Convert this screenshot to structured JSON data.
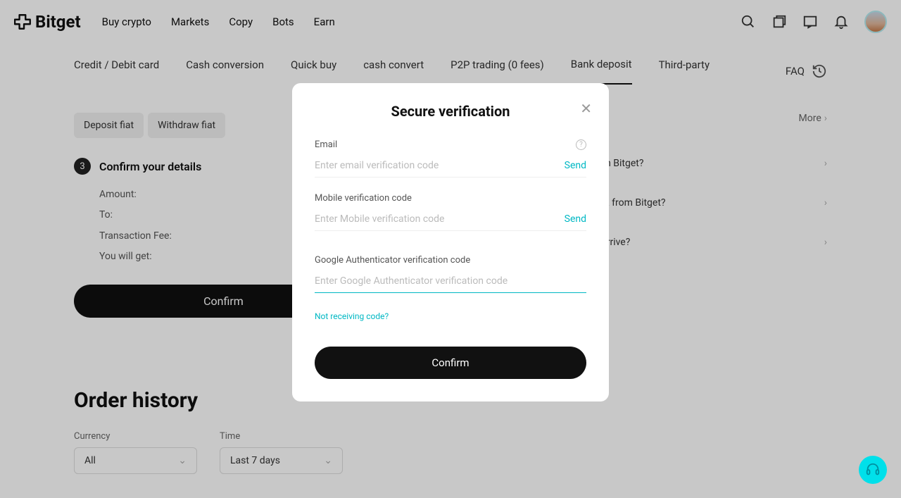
{
  "header": {
    "logo": "Bitget",
    "nav": {
      "buy": "Buy crypto",
      "markets": "Markets",
      "copy": "Copy",
      "bots": "Bots",
      "earn": "Earn"
    }
  },
  "subtabs": {
    "credit": "Credit / Debit card",
    "cash_conv": "Cash conversion",
    "quick_buy": "Quick buy",
    "cash_convert": "cash convert",
    "p2p": "P2P trading (0 fees)",
    "bank": "Bank deposit",
    "third": "Third-party",
    "faq": "FAQ"
  },
  "chips": {
    "deposit": "Deposit fiat",
    "withdraw": "Withdraw fiat"
  },
  "step": {
    "num": "3",
    "title": "Confirm your details"
  },
  "details": {
    "amount": "Amount:",
    "to": "To:",
    "fee": "Transaction Fee:",
    "get": "You will get:"
  },
  "confirm_label": "Confirm",
  "right": {
    "more": "More",
    "faq1_suffix": "R on Bitget?",
    "faq2_suffix": "EUR from Bitget?",
    "faq3_suffix": "ls arrive?"
  },
  "order_history": {
    "title": "Order history",
    "currency_label": "Currency",
    "currency_value": "All",
    "time_label": "Time",
    "time_value": "Last 7 days"
  },
  "modal": {
    "title": "Secure verification",
    "email_label": "Email",
    "email_placeholder": "Enter email verification code",
    "email_send": "Send",
    "mobile_label": "Mobile verification code",
    "mobile_placeholder": "Enter Mobile verification code",
    "mobile_send": "Send",
    "ga_label": "Google Authenticator verification code",
    "ga_placeholder": "Enter Google Authenticator verification code",
    "not_receiving": "Not receiving code?",
    "confirm": "Confirm"
  },
  "colors": {
    "accent": "#00b8c4"
  }
}
